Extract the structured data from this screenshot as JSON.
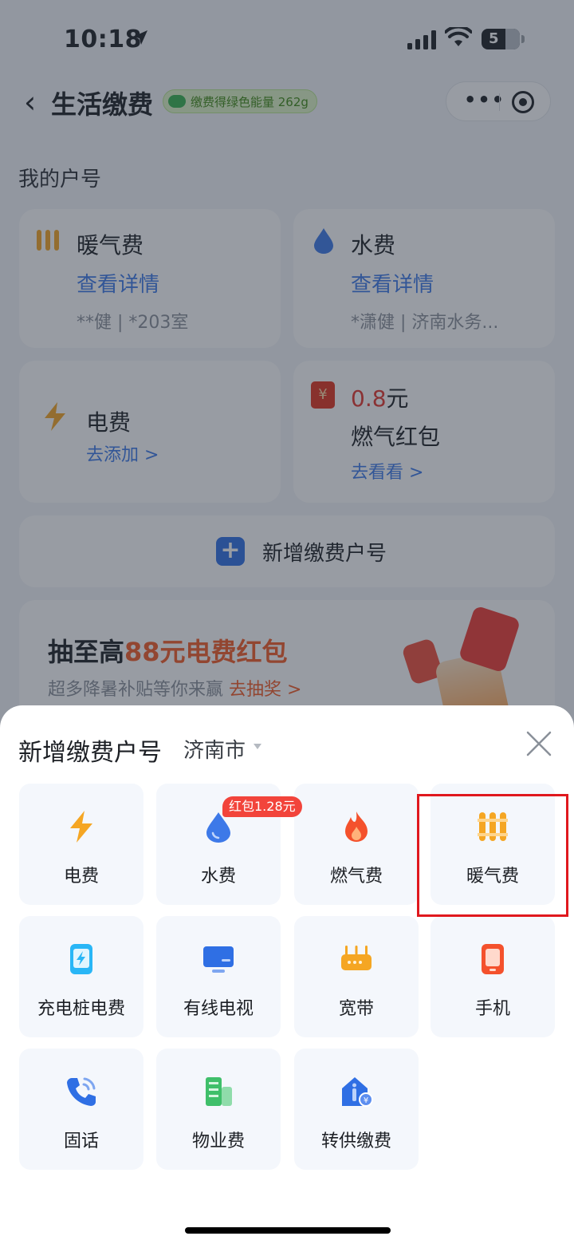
{
  "status_bar": {
    "time": "10:18",
    "battery": "5"
  },
  "nav": {
    "title": "生活缴费",
    "energy_badge": "缴费得绿色能量 262g",
    "back_icon": "chevron-left-icon",
    "more_icon": "more-dots-icon",
    "capsule_icon": "target-icon"
  },
  "accounts": {
    "title": "我的户号",
    "heating": {
      "name": "暖气费",
      "link": "查看详情",
      "detail": "**健 | *203室",
      "icon": "radiator-icon"
    },
    "water": {
      "name": "水费",
      "link": "查看详情",
      "detail": "*潇健 | 济南水务...",
      "icon": "water-drop-icon"
    },
    "electricity": {
      "name": "电费",
      "add_link": "去添加 >",
      "icon": "lightning-icon"
    },
    "gas_packet": {
      "amount": "0.8",
      "unit": "元",
      "name": "燃气红包",
      "link": "去看看 >",
      "icon": "red-packet-icon"
    },
    "add_account": "新增缴费户号"
  },
  "promo": {
    "title_prefix": "抽至高",
    "title_highlight": "88元电费红包",
    "subtitle": "超多降暑补贴等你来赢",
    "subtitle_link": "去抽奖 >"
  },
  "sheet": {
    "title": "新增缴费户号",
    "city": "济南市",
    "close_icon": "close-icon",
    "water_badge": "红包1.28元",
    "items": [
      {
        "label": "电费",
        "icon": "lightning-icon"
      },
      {
        "label": "水费",
        "icon": "water-drop-icon"
      },
      {
        "label": "燃气费",
        "icon": "flame-icon"
      },
      {
        "label": "暖气费",
        "icon": "radiator-icon"
      },
      {
        "label": "充电桩电费",
        "icon": "charging-pile-icon"
      },
      {
        "label": "有线电视",
        "icon": "tv-icon"
      },
      {
        "label": "宽带",
        "icon": "router-icon"
      },
      {
        "label": "手机",
        "icon": "phone-icon"
      },
      {
        "label": "固话",
        "icon": "telephone-icon"
      },
      {
        "label": "物业费",
        "icon": "building-icon"
      },
      {
        "label": "转供缴费",
        "icon": "transfer-house-icon"
      }
    ]
  },
  "colors": {
    "accent_blue": "#3d79e8",
    "promo_orange": "#f45a26",
    "highlight_red": "#e0181e"
  }
}
